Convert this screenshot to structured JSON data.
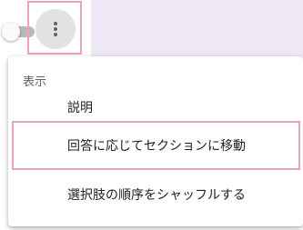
{
  "menu": {
    "section_header": "表示",
    "items": [
      {
        "label": "説明"
      },
      {
        "label": "回答に応じてセクションに移動"
      },
      {
        "label": "選択肢の順序をシャッフルする"
      }
    ]
  },
  "icons": {
    "more": "more-vert-icon"
  },
  "colors": {
    "highlight_border": "#e8a1bf",
    "backdrop_accent": "#ede7f6"
  }
}
